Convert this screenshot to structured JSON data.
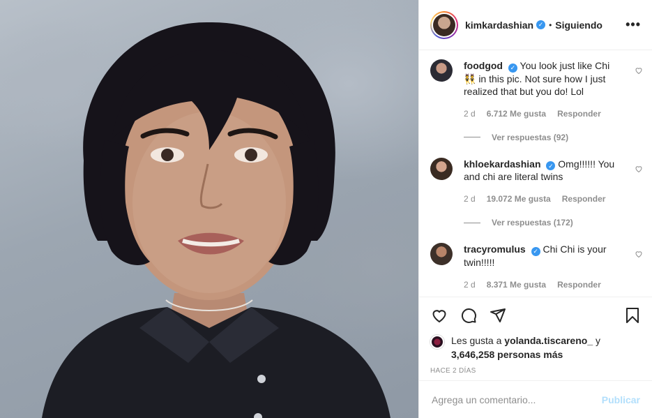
{
  "post": {
    "image_alt": "Yearbook-style portrait photo",
    "author": {
      "username": "kimkardashian",
      "verified": true,
      "follow_status": "Siguiendo",
      "more_icon": "more-horizontal-icon"
    }
  },
  "comments": [
    {
      "username": "foodgod",
      "verified": true,
      "text": "You look just like Chi 👯 in this pic. Not sure how I just realized that but you do! Lol",
      "time": "2 d",
      "likes": "6.712 Me gusta",
      "reply_label": "Responder",
      "view_replies": "Ver respuestas (92)"
    },
    {
      "username": "khloekardashian",
      "verified": true,
      "text": "Omg!!!!!! You and chi are literal twins",
      "time": "2 d",
      "likes": "19.072 Me gusta",
      "reply_label": "Responder",
      "view_replies": "Ver respuestas (172)"
    },
    {
      "username": "tracyromulus",
      "verified": true,
      "text": "Chi Chi is your twin!!!!!",
      "time": "2 d",
      "likes": "8.371 Me gusta",
      "reply_label": "Responder",
      "view_replies": ""
    }
  ],
  "actions": {
    "like_icon": "heart-icon",
    "comment_icon": "comment-icon",
    "share_icon": "share-icon",
    "save_icon": "bookmark-icon"
  },
  "likes": {
    "prefix": "Les gusta a ",
    "user": "yolanda.tiscareno_",
    "connector": " y",
    "count": "3,646,258 personas más"
  },
  "time_ago": "HACE 2 DÍAS",
  "composer": {
    "placeholder": "Agrega un comentario...",
    "publish_label": "Publicar"
  },
  "colors": {
    "accent": "#3897f0",
    "publish_disabled": "#b2dffc",
    "muted": "#8e8e8e",
    "border": "#efefef"
  }
}
